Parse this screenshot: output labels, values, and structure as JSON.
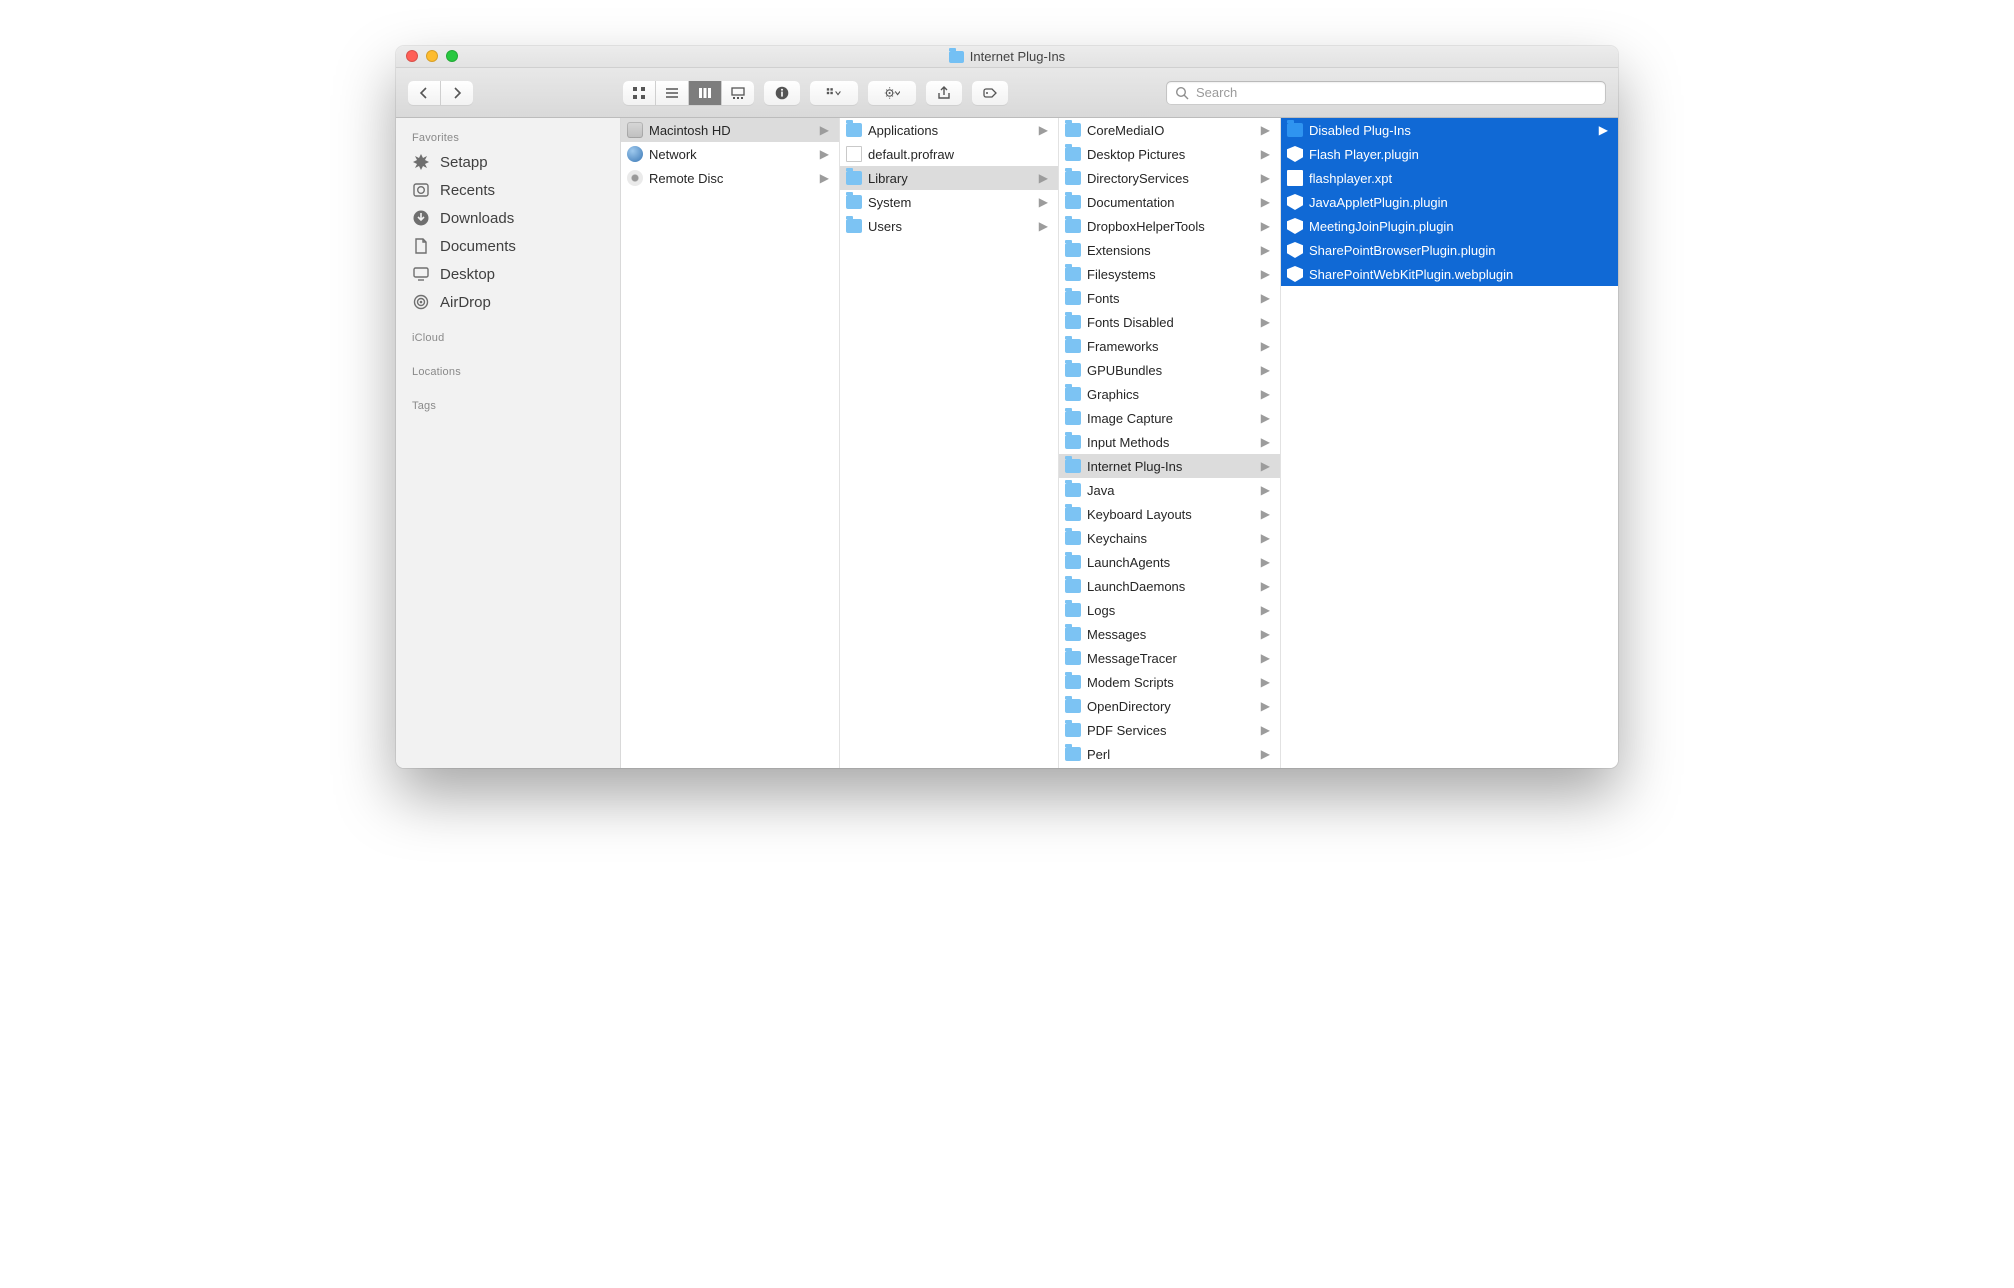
{
  "window": {
    "title": "Internet Plug-Ins"
  },
  "search": {
    "placeholder": "Search"
  },
  "sidebar": {
    "sections": [
      {
        "header": "Favorites",
        "items": [
          {
            "label": "Setapp",
            "icon": "setapp"
          },
          {
            "label": "Recents",
            "icon": "recents"
          },
          {
            "label": "Downloads",
            "icon": "downloads"
          },
          {
            "label": "Documents",
            "icon": "documents"
          },
          {
            "label": "Desktop",
            "icon": "desktop"
          },
          {
            "label": "AirDrop",
            "icon": "airdrop"
          }
        ]
      },
      {
        "header": "iCloud",
        "items": []
      },
      {
        "header": "Locations",
        "items": []
      },
      {
        "header": "Tags",
        "items": []
      }
    ]
  },
  "columns": [
    {
      "items": [
        {
          "label": "Macintosh HD",
          "icon": "drive",
          "arrow": true,
          "sel": "gray"
        },
        {
          "label": "Network",
          "icon": "globe",
          "arrow": true
        },
        {
          "label": "Remote Disc",
          "icon": "disc",
          "arrow": true
        }
      ]
    },
    {
      "items": [
        {
          "label": "Applications",
          "icon": "folder",
          "arrow": true
        },
        {
          "label": "default.profraw",
          "icon": "file"
        },
        {
          "label": "Library",
          "icon": "folder",
          "arrow": true,
          "sel": "gray"
        },
        {
          "label": "System",
          "icon": "folder",
          "arrow": true
        },
        {
          "label": "Users",
          "icon": "folder",
          "arrow": true
        }
      ]
    },
    {
      "items": [
        {
          "label": "CoreMediaIO",
          "icon": "folder",
          "arrow": true
        },
        {
          "label": "Desktop Pictures",
          "icon": "folder",
          "arrow": true
        },
        {
          "label": "DirectoryServices",
          "icon": "folder",
          "arrow": true
        },
        {
          "label": "Documentation",
          "icon": "folder",
          "arrow": true
        },
        {
          "label": "DropboxHelperTools",
          "icon": "folder",
          "arrow": true
        },
        {
          "label": "Extensions",
          "icon": "folder",
          "arrow": true
        },
        {
          "label": "Filesystems",
          "icon": "folder",
          "arrow": true
        },
        {
          "label": "Fonts",
          "icon": "folder",
          "arrow": true
        },
        {
          "label": "Fonts Disabled",
          "icon": "folder",
          "arrow": true
        },
        {
          "label": "Frameworks",
          "icon": "folder",
          "arrow": true
        },
        {
          "label": "GPUBundles",
          "icon": "folder",
          "arrow": true
        },
        {
          "label": "Graphics",
          "icon": "folder",
          "arrow": true
        },
        {
          "label": "Image Capture",
          "icon": "folder",
          "arrow": true
        },
        {
          "label": "Input Methods",
          "icon": "folder",
          "arrow": true
        },
        {
          "label": "Internet Plug-Ins",
          "icon": "folder",
          "arrow": true,
          "sel": "gray"
        },
        {
          "label": "Java",
          "icon": "folder",
          "arrow": true
        },
        {
          "label": "Keyboard Layouts",
          "icon": "folder",
          "arrow": true
        },
        {
          "label": "Keychains",
          "icon": "folder",
          "arrow": true
        },
        {
          "label": "LaunchAgents",
          "icon": "folder",
          "arrow": true
        },
        {
          "label": "LaunchDaemons",
          "icon": "folder",
          "arrow": true
        },
        {
          "label": "Logs",
          "icon": "folder",
          "arrow": true
        },
        {
          "label": "Messages",
          "icon": "folder",
          "arrow": true
        },
        {
          "label": "MessageTracer",
          "icon": "folder",
          "arrow": true
        },
        {
          "label": "Modem Scripts",
          "icon": "folder",
          "arrow": true
        },
        {
          "label": "OpenDirectory",
          "icon": "folder",
          "arrow": true
        },
        {
          "label": "PDF Services",
          "icon": "folder",
          "arrow": true
        },
        {
          "label": "Perl",
          "icon": "folder",
          "arrow": true
        }
      ]
    },
    {
      "items": [
        {
          "label": "Disabled Plug-Ins",
          "icon": "folder-bright",
          "arrow": true,
          "sel": "blue"
        },
        {
          "label": "Flash Player.plugin",
          "icon": "plugin",
          "sel": "blue"
        },
        {
          "label": "flashplayer.xpt",
          "icon": "file",
          "sel": "blue"
        },
        {
          "label": "JavaAppletPlugin.plugin",
          "icon": "plugin",
          "sel": "blue"
        },
        {
          "label": "MeetingJoinPlugin.plugin",
          "icon": "plugin",
          "sel": "blue"
        },
        {
          "label": "SharePointBrowserPlugin.plugin",
          "icon": "plugin",
          "sel": "blue"
        },
        {
          "label": "SharePointWebKitPlugin.webplugin",
          "icon": "plugin",
          "sel": "blue"
        }
      ]
    }
  ]
}
